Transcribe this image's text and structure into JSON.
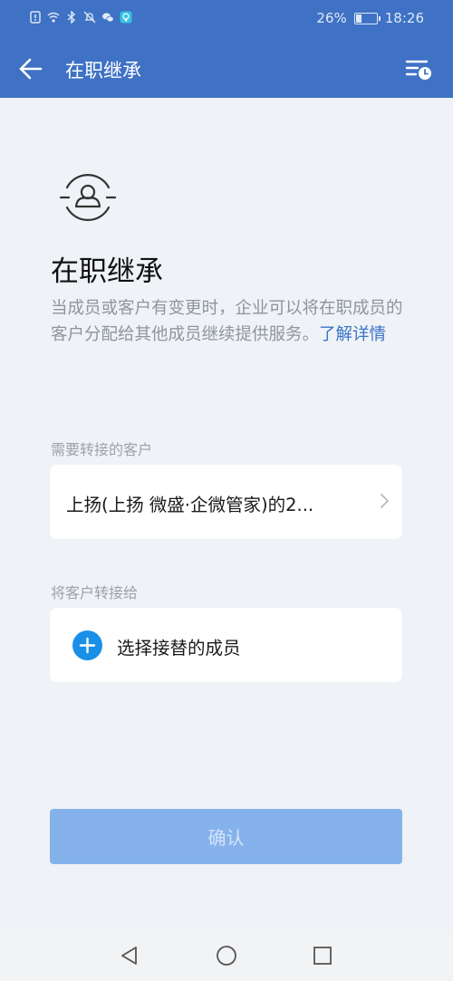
{
  "status_bar": {
    "battery": "26%",
    "battery_level": 0.26,
    "time": "18:26",
    "icons": [
      "sim-icon",
      "wifi-icon",
      "bluetooth-icon",
      "mute-icon",
      "wechat-icon",
      "notification-icon"
    ]
  },
  "header": {
    "title": "在职继承",
    "back_icon": "arrow-left-icon",
    "menu_icon": "list-clock-icon"
  },
  "main": {
    "title": "在职继承",
    "description": "当成员或客户有变更时，企业可以将在职成员的客户分配给其他成员继续提供服务。",
    "learn_more": "了解详情",
    "customers_label": "需要转接的客户",
    "customers_value": "上扬(上扬 微盛·企微管家)的2...",
    "transfer_label": "将客户转接给",
    "select_member": "选择接替的成员",
    "confirm": "确认"
  },
  "colors": {
    "header": "#3f72c5",
    "link": "#3b74c8",
    "plus": "#1a8fe8",
    "confirm_disabled": "#86b2ec"
  }
}
